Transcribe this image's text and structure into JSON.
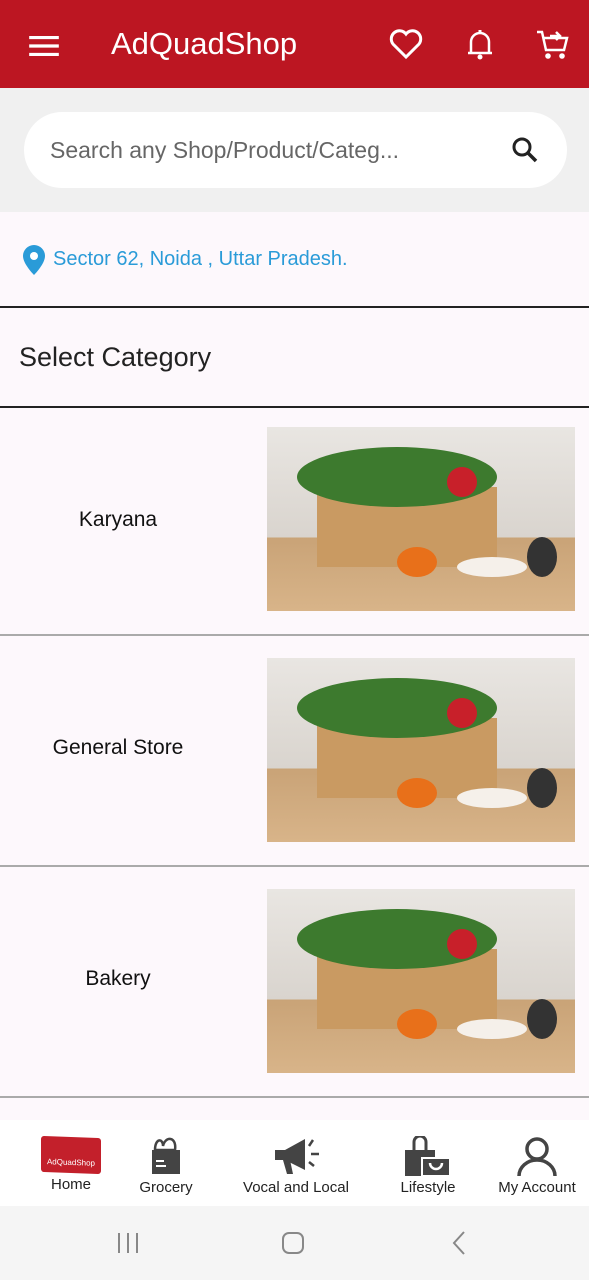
{
  "header": {
    "title": "AdQuadShop",
    "icons": [
      "menu-icon",
      "heart-icon",
      "bell-icon",
      "cart-icon"
    ],
    "color": "#bc1622"
  },
  "search": {
    "placeholder": "Search any Shop/Product/Categ..."
  },
  "location": {
    "text": "Sector 62, Noida , Uttar Pradesh."
  },
  "section_title": "Select Category",
  "categories": [
    {
      "label": "Karyana"
    },
    {
      "label": "General Store"
    },
    {
      "label": "Bakery"
    }
  ],
  "bottom_nav": {
    "logo_text": "AdQuadShop",
    "items": [
      {
        "label": "Home"
      },
      {
        "label": "Grocery"
      },
      {
        "label": "Vocal and Local"
      },
      {
        "label": "Lifestyle"
      },
      {
        "label": "My Account"
      }
    ]
  }
}
